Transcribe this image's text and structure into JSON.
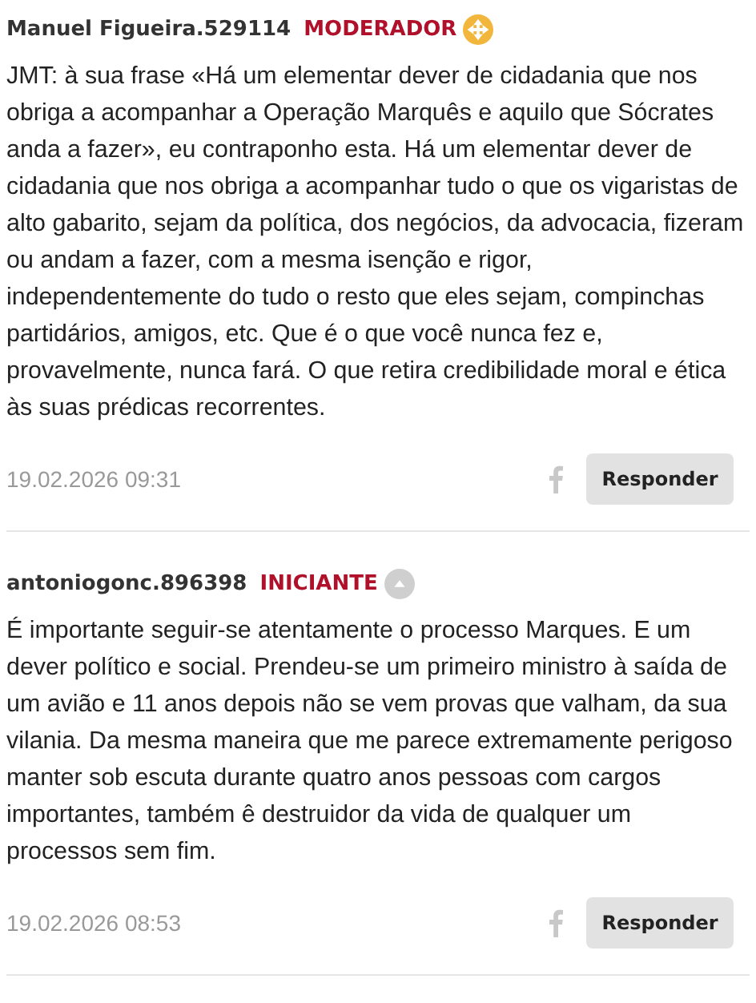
{
  "comments": [
    {
      "author": "Manuel Figueira.529114",
      "role": "MODERADOR",
      "kind": "moderator",
      "text": "JMT: à sua frase «Há um elementar dever de cidadania que nos obriga a acompanhar a Operação Marquês e aquilo que Sócrates anda a fazer», eu contraponho esta. Há um elementar dever de cidadania que nos obriga a acompanhar tudo o que os vigaristas de alto gabarito, sejam da política, dos negócios, da advocacia, fizeram ou andam a fazer, com a mesma isenção e rigor, independentemente do tudo o resto que eles sejam, compinchas partidários, amigos, etc. Que é o que você nunca fez e, provavelmente, nunca fará. O que retira credibilidade moral e ética às suas prédicas recorrentes.",
      "date": "19.02.2026 09:31",
      "reply": "Responder"
    },
    {
      "author": "antoniogonc.896398",
      "role": "INICIANTE",
      "kind": "beginner",
      "text": "É importante seguir-se atentamente o processo Marques. E um dever político e social. Prendeu-se um primeiro ministro à saída de um avião e 11 anos depois não se vem provas que valham, da sua vilania. Da mesma maneira que me parece extremamente perigoso manter sob escuta durante quatro anos pessoas com cargos importantes, também ê destruidor da vida de qualquer um processos sem fim.",
      "date": "19.02.2026 08:53",
      "reply": "Responder"
    }
  ]
}
